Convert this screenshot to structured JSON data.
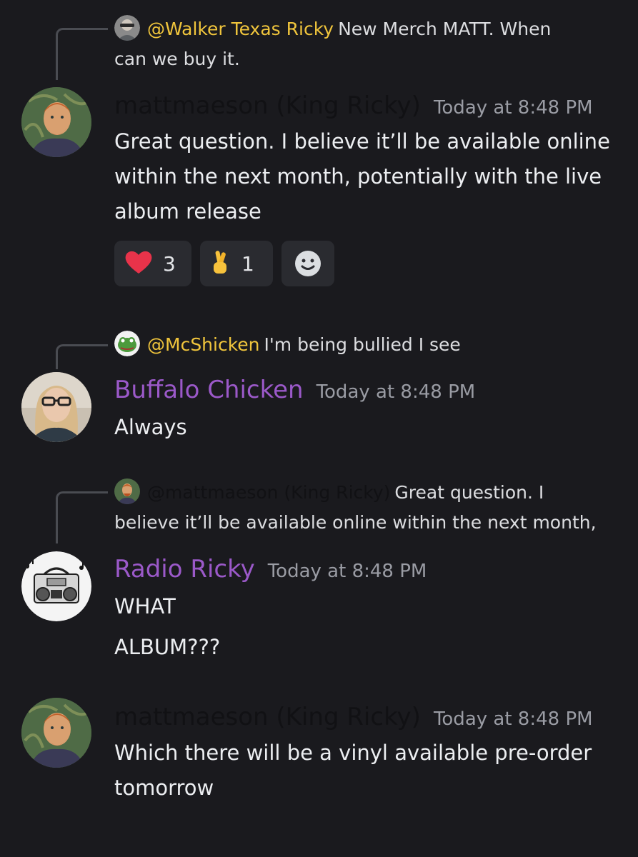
{
  "messages": [
    {
      "reply": {
        "author": "@Walker Texas Ricky",
        "author_color": "#f0c53c",
        "text_line1": "New Merch MATT. When",
        "text_line2": "can we buy it."
      },
      "author": "mattmaeson (King Ricky)",
      "author_color": "#111114",
      "timestamp": "Today at 8:48 PM",
      "body": "Great question. I believe it’ll be available online within the next month, potentially with the live album release",
      "reactions": [
        {
          "emoji": "heart-emoji",
          "count": "3"
        },
        {
          "emoji": "crossed-fingers-emoji",
          "count": "1"
        }
      ]
    },
    {
      "reply": {
        "author": "@McShicken",
        "author_color": "#f0c53c",
        "text_line1": "I'm being bullied I see"
      },
      "author": "Buffalo Chicken",
      "author_color": "#9b59c9",
      "timestamp": "Today at 8:48 PM",
      "body": "Always"
    },
    {
      "reply": {
        "author": "@mattmaeson (King Ricky)",
        "author_color": "#111114",
        "text_line1": "Great question. I",
        "text_line2": "believe it’ll be available online within the next month,"
      },
      "author": "Radio Ricky",
      "author_color": "#9b59c9",
      "timestamp": "Today at 8:48 PM",
      "body_line1": "WHAT",
      "body_line2": "ALBUM???"
    },
    {
      "author": "mattmaeson (King Ricky)",
      "author_color": "#111114",
      "timestamp": "Today at 8:48 PM",
      "body": "Which there will be a vinyl available pre-order tomorrow"
    }
  ]
}
